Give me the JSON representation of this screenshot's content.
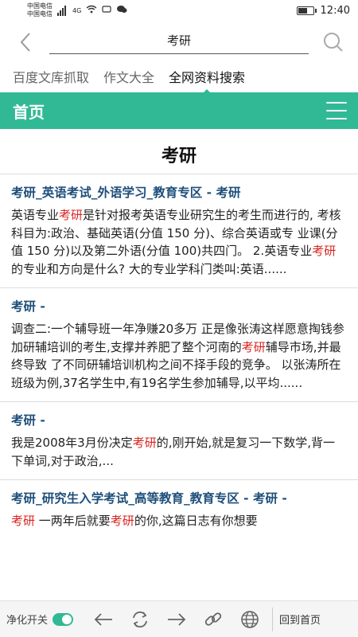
{
  "status_bar": {
    "carrier1": "中国电信",
    "carrier2": "中国电信",
    "network": "4G",
    "time": "12:40"
  },
  "search": {
    "query": "考研"
  },
  "tabs": [
    {
      "label": "百度文库抓取"
    },
    {
      "label": "作文大全"
    },
    {
      "label": "全网资料搜索"
    }
  ],
  "topbar": {
    "title": "首页"
  },
  "page": {
    "heading": "考研"
  },
  "results": [
    {
      "title": "考研_英语考试_外语学习_教育专区 - 考研",
      "body_parts": [
        "英语专业",
        "考研",
        "是针对报考英语专业研究生的考生而进行的, 考核科目为:政治、基础英语(分值 150 分)、综合英语或专 业课(分值 150 分)以及第二外语(分值 100)共四门。 2.英语专业",
        "考研",
        "的专业和方向是什么? 大的专业学科门类叫:英语......"
      ]
    },
    {
      "title": "考研 -",
      "body_parts": [
        "调查二:一个辅导班一年净赚20多万 正是像张涛这样愿意掏钱参加研辅培训的考生,支撑并养肥了整个河南的",
        "考研",
        "辅导市场,并最终导致 了不同研辅培训机构之间不择手段的竞争。 以张涛所在班级为例,37名学生中,有19名学生参加辅导,以平均......"
      ]
    },
    {
      "title": "考研 -",
      "body_parts": [
        "我是2008年3月份决定",
        "考研",
        "的,刚开始,就是复习一下数学,背一下单词,对于政治,..."
      ]
    },
    {
      "title": "考研_研究生入学考试_高等教育_教育专区 - 考研 -",
      "body_parts": [
        "考研",
        " 一两年后就要",
        "考研",
        "的你,这篇日志有你想要"
      ]
    }
  ],
  "bottom_bar": {
    "purify_label": "净化开关",
    "purify_on": true,
    "back_home_label": "回到首页"
  },
  "colors": {
    "accent": "#31b995",
    "title_blue": "#1d4e7a",
    "highlight_red": "#d8241f"
  },
  "icons": [
    "back-arrow-icon",
    "search-icon",
    "menu-icon",
    "arrow-left-icon",
    "refresh-icon",
    "arrow-right-icon",
    "link-icon",
    "globe-icon"
  ]
}
